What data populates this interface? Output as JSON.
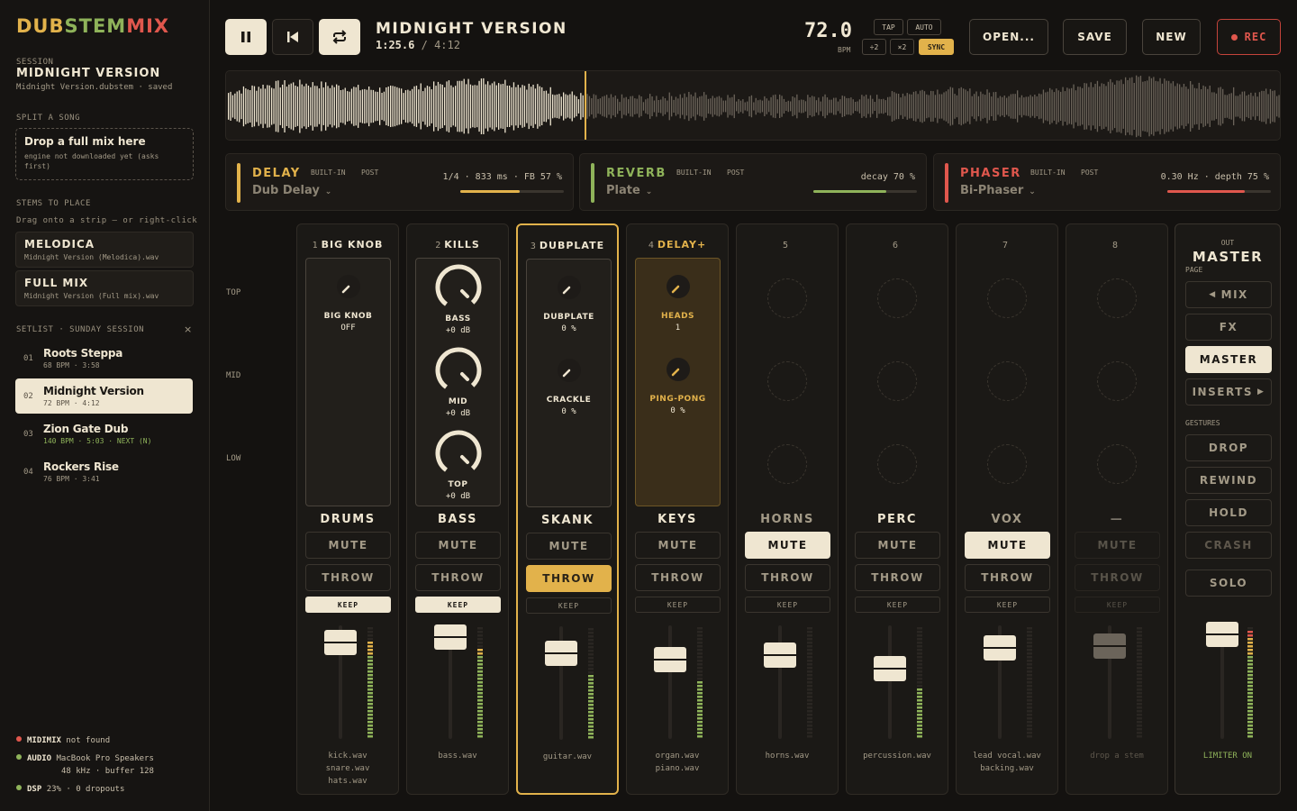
{
  "app": {
    "logo": "DUBSTEMMIX"
  },
  "session": {
    "label": "SESSION",
    "title": "MIDNIGHT VERSION",
    "file": "Midnight Version.dubstem · saved"
  },
  "split": {
    "label": "SPLIT A SONG",
    "drop_title": "Drop a full mix here",
    "drop_note": "engine not downloaded yet (asks first)"
  },
  "stems": {
    "label": "STEMS TO PLACE",
    "hint": "Drag onto a strip — or right-click",
    "items": [
      {
        "name": "MELODICA",
        "file": "Midnight Version (Melodica).wav"
      },
      {
        "name": "FULL MIX",
        "file": "Midnight Version (Full mix).wav"
      }
    ]
  },
  "setlist": {
    "label": "SETLIST · SUNDAY SESSION",
    "close": "×",
    "items": [
      {
        "num": "01",
        "title": "Roots Steppa",
        "meta": "68 BPM · 3:58"
      },
      {
        "num": "02",
        "title": "Midnight Version",
        "meta": "72 BPM · 4:12"
      },
      {
        "num": "03",
        "title": "Zion Gate Dub",
        "meta": "140 BPM · 5:03 · NEXT (N)"
      },
      {
        "num": "04",
        "title": "Rockers Rise",
        "meta": "76 BPM · 3:41"
      }
    ]
  },
  "status": {
    "midi_name": "MIDIMIX",
    "midi_state": "not found",
    "audio_name": "AUDIO",
    "audio_device": "MacBook Pro Speakers",
    "audio_detail": "48 kHz · buffer 128",
    "dsp_name": "DSP",
    "dsp_detail": "23% · 0 dropouts"
  },
  "colors": {
    "accent": "#e2b24b",
    "cream": "#efe6d1",
    "delay": "#e2b24b",
    "reverb": "#8fb35a",
    "phaser": "#e0574d",
    "rec": "#e0574d",
    "ok": "#8fb35a"
  },
  "transport": {
    "title": "MIDNIGHT VERSION",
    "position": "1:25.6",
    "sep": "/",
    "duration": "4:12",
    "bpm": "72.0",
    "bpm_label": "BPM",
    "tap": "TAP",
    "auto": "AUTO",
    "half": "÷2",
    "double": "×2",
    "sync": "SYNC",
    "open": "OPEN...",
    "save": "SAVE",
    "new": "NEW",
    "rec": "REC",
    "progress": 0.34
  },
  "fx": [
    {
      "name": "DELAY",
      "tag1": "BUILT-IN",
      "tag2": "POST",
      "preset": "Dub Delay",
      "params": "1/4 · 833 ms · FB 57 %",
      "amount": 0.57
    },
    {
      "name": "REVERB",
      "tag1": "BUILT-IN",
      "tag2": "POST",
      "preset": "Plate",
      "params": "decay 70 %",
      "amount": 0.7
    },
    {
      "name": "PHASER",
      "tag1": "BUILT-IN",
      "tag2": "POST",
      "preset": "Bi-Phaser",
      "params": "0.30 Hz · depth 75 %",
      "amount": 0.75
    }
  ],
  "zones": {
    "top": "TOP",
    "mid": "MID",
    "low": "LOW"
  },
  "strips": [
    {
      "num": "1",
      "title": "BIG KNOB",
      "name": "DRUMS",
      "knobs": [
        {
          "label": "BIG KNOB",
          "value": "OFF"
        }
      ],
      "mute": false,
      "throw": false,
      "keep": true,
      "fader": 0.85,
      "level": 0.85,
      "files": [
        "kick.wav",
        "snare.wav",
        "hats.wav"
      ]
    },
    {
      "num": "2",
      "title": "KILLS",
      "name": "BASS",
      "knobs": [
        {
          "label": "BASS",
          "value": "+0 dB"
        },
        {
          "label": "MID",
          "value": "+0 dB"
        },
        {
          "label": "TOP",
          "value": "+0 dB"
        }
      ],
      "mute": false,
      "throw": false,
      "keep": true,
      "fader": 0.9,
      "level": 0.78,
      "files": [
        "bass.wav"
      ]
    },
    {
      "num": "3",
      "title": "DUBPLATE",
      "name": "SKANK",
      "knobs": [
        {
          "label": "DUBPLATE",
          "value": "0 %"
        },
        {
          "label": "CRACKLE",
          "value": "0 %"
        }
      ],
      "mute": false,
      "throw": true,
      "keep": false,
      "fader": 0.76,
      "level": 0.58,
      "files": [
        "guitar.wav"
      ]
    },
    {
      "num": "4",
      "title": "DELAY+",
      "name": "KEYS",
      "knobs": [
        {
          "label": "HEADS",
          "value": "1"
        },
        {
          "label": "PING-PONG",
          "value": "0 %"
        }
      ],
      "mute": false,
      "throw": false,
      "keep": false,
      "fader": 0.7,
      "level": 0.5,
      "files": [
        "organ.wav",
        "piano.wav"
      ]
    },
    {
      "num": "5",
      "title": "",
      "name": "HORNS",
      "knobs": [],
      "mute": true,
      "throw": false,
      "keep": false,
      "fader": 0.74,
      "level": 0,
      "files": [
        "horns.wav"
      ]
    },
    {
      "num": "6",
      "title": "",
      "name": "PERC",
      "knobs": [],
      "mute": false,
      "throw": false,
      "keep": false,
      "fader": 0.62,
      "level": 0.42,
      "files": [
        "percussion.wav"
      ]
    },
    {
      "num": "7",
      "title": "",
      "name": "VOX",
      "knobs": [],
      "mute": true,
      "throw": false,
      "keep": false,
      "fader": 0.8,
      "level": 0,
      "files": [
        "lead vocal.wav",
        "backing.wav"
      ]
    },
    {
      "num": "8",
      "title": "",
      "name": "—",
      "knobs": [],
      "mute": false,
      "throw": false,
      "keep": false,
      "fader": 0.82,
      "level": 0,
      "files": [
        "drop a stem"
      ],
      "empty": true
    }
  ],
  "labels": {
    "mute": "MUTE",
    "throw": "THROW",
    "keep": "KEEP"
  },
  "master": {
    "out": "OUT",
    "title": "MASTER",
    "page": "PAGE",
    "mix": "MIX",
    "fx": "FX",
    "master": "MASTER",
    "inserts": "INSERTS",
    "gestures": "GESTURES",
    "drop": "DROP",
    "rewind": "REWIND",
    "hold": "HOLD",
    "crash": "CRASH",
    "solo": "SOLO",
    "limiter": "LIMITER ON",
    "fader": 0.92,
    "level": 0.95
  }
}
